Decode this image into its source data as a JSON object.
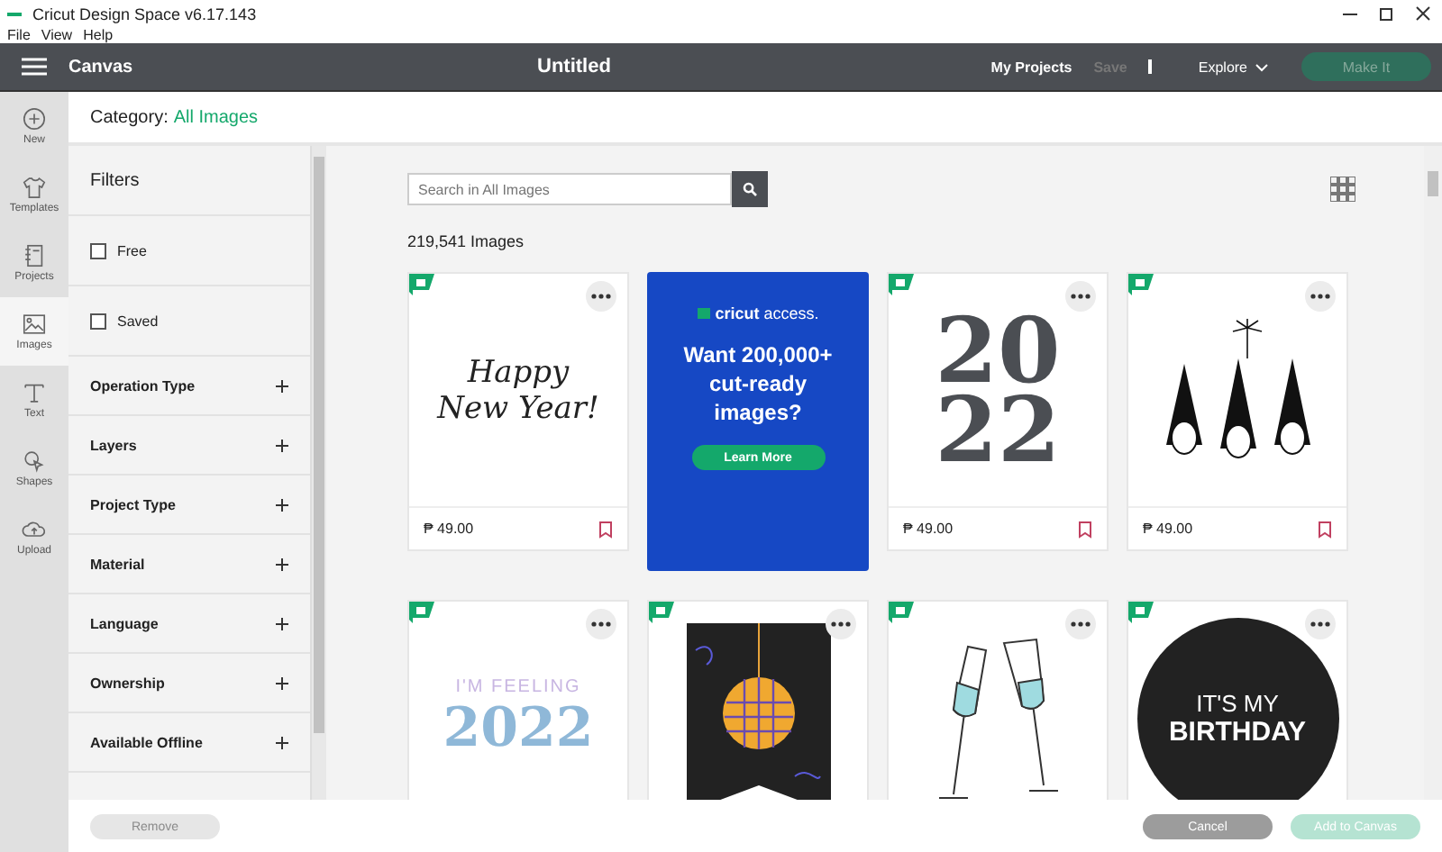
{
  "window": {
    "title": "Cricut Design Space  v6.17.143"
  },
  "menu": [
    "File",
    "View",
    "Help"
  ],
  "topbar": {
    "section": "Canvas",
    "doc_title": "Untitled",
    "links": [
      {
        "label": "My Projects",
        "disabled": false
      },
      {
        "label": "Save",
        "disabled": true
      }
    ],
    "explore": "Explore",
    "make_it": "Make It"
  },
  "rail": [
    {
      "label": "New",
      "kind": "plus",
      "selected": false
    },
    {
      "label": "Templates",
      "kind": "shirt",
      "selected": false
    },
    {
      "label": "Projects",
      "kind": "book",
      "selected": false
    },
    {
      "label": "Images",
      "kind": "image",
      "selected": true
    },
    {
      "label": "Text",
      "kind": "text",
      "selected": false
    },
    {
      "label": "Shapes",
      "kind": "shapes",
      "selected": false
    },
    {
      "label": "Upload",
      "kind": "cloud",
      "selected": false
    }
  ],
  "category": {
    "label": "Category:",
    "value": "All Images"
  },
  "filters": {
    "title": "Filters",
    "checks": [
      {
        "label": "Free",
        "checked": false
      },
      {
        "label": "Saved",
        "checked": false
      }
    ],
    "sections": [
      "Operation Type",
      "Layers",
      "Project Type",
      "Material",
      "Language",
      "Ownership",
      "Available Offline"
    ]
  },
  "search": {
    "placeholder": "Search in All Images"
  },
  "count": "219,541 Images",
  "cards": [
    {
      "kind": "script",
      "art": [
        "Happy",
        "New Year!"
      ],
      "price": "₱ 49.00",
      "saved": false
    },
    {
      "kind": "ad",
      "brand": "cricut",
      "brand2": "access.",
      "headline": "Want 200,000+ cut-ready images?",
      "button": "Learn More"
    },
    {
      "kind": "numbers",
      "art": [
        "20",
        "22"
      ],
      "price": "₱ 49.00",
      "saved": false
    },
    {
      "kind": "gnomes",
      "price": "₱ 49.00",
      "saved": false
    },
    {
      "kind": "feeling",
      "art": [
        "I'M FEELING",
        "2022"
      ]
    },
    {
      "kind": "disco"
    },
    {
      "kind": "glasses"
    },
    {
      "kind": "birthday",
      "art": [
        "IT'S MY",
        "BIRTHDAY"
      ]
    }
  ],
  "footer": {
    "remove": "Remove",
    "cancel": "Cancel",
    "add": "Add to Canvas"
  }
}
